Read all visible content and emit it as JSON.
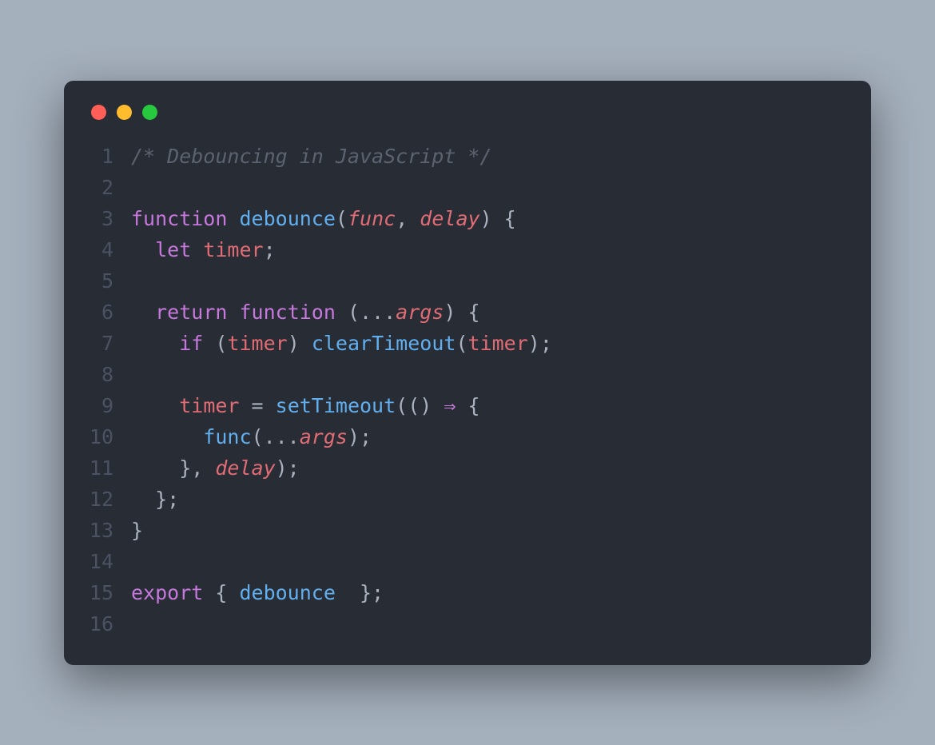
{
  "window": {
    "buttons": [
      "close",
      "minimize",
      "zoom"
    ]
  },
  "code": {
    "lines": [
      {
        "num": "1",
        "tokens": [
          {
            "cls": "tok-comment",
            "t": "/* Debouncing in JavaScript */"
          }
        ]
      },
      {
        "num": "2",
        "tokens": []
      },
      {
        "num": "3",
        "tokens": [
          {
            "cls": "tok-keyword",
            "t": "function"
          },
          {
            "cls": "tok-punct",
            "t": " "
          },
          {
            "cls": "tok-funcname",
            "t": "debounce"
          },
          {
            "cls": "tok-punct",
            "t": "("
          },
          {
            "cls": "tok-param",
            "t": "func"
          },
          {
            "cls": "tok-punct",
            "t": ", "
          },
          {
            "cls": "tok-param",
            "t": "delay"
          },
          {
            "cls": "tok-punct",
            "t": ") {"
          }
        ]
      },
      {
        "num": "4",
        "tokens": [
          {
            "cls": "tok-punct",
            "t": "  "
          },
          {
            "cls": "tok-let",
            "t": "let"
          },
          {
            "cls": "tok-punct",
            "t": " "
          },
          {
            "cls": "tok-var",
            "t": "timer"
          },
          {
            "cls": "tok-punct",
            "t": ";"
          }
        ]
      },
      {
        "num": "5",
        "tokens": []
      },
      {
        "num": "6",
        "tokens": [
          {
            "cls": "tok-punct",
            "t": "  "
          },
          {
            "cls": "tok-keyword",
            "t": "return"
          },
          {
            "cls": "tok-punct",
            "t": " "
          },
          {
            "cls": "tok-keyword",
            "t": "function"
          },
          {
            "cls": "tok-punct",
            "t": " (..."
          },
          {
            "cls": "tok-param",
            "t": "args"
          },
          {
            "cls": "tok-punct",
            "t": ") {"
          }
        ]
      },
      {
        "num": "7",
        "tokens": [
          {
            "cls": "tok-punct",
            "t": "    "
          },
          {
            "cls": "tok-keyword",
            "t": "if"
          },
          {
            "cls": "tok-punct",
            "t": " ("
          },
          {
            "cls": "tok-var",
            "t": "timer"
          },
          {
            "cls": "tok-punct",
            "t": ") "
          },
          {
            "cls": "tok-funcname",
            "t": "clearTimeout"
          },
          {
            "cls": "tok-punct",
            "t": "("
          },
          {
            "cls": "tok-var",
            "t": "timer"
          },
          {
            "cls": "tok-punct",
            "t": ");"
          }
        ]
      },
      {
        "num": "8",
        "tokens": []
      },
      {
        "num": "9",
        "tokens": [
          {
            "cls": "tok-punct",
            "t": "    "
          },
          {
            "cls": "tok-var",
            "t": "timer"
          },
          {
            "cls": "tok-punct",
            "t": " = "
          },
          {
            "cls": "tok-funcname",
            "t": "setTimeout"
          },
          {
            "cls": "tok-punct",
            "t": "(() "
          },
          {
            "cls": "tok-arrow",
            "t": "⇒"
          },
          {
            "cls": "tok-punct",
            "t": " {"
          }
        ]
      },
      {
        "num": "10",
        "tokens": [
          {
            "cls": "tok-punct",
            "t": "      "
          },
          {
            "cls": "tok-funcname",
            "t": "func"
          },
          {
            "cls": "tok-punct",
            "t": "(..."
          },
          {
            "cls": "tok-param",
            "t": "args"
          },
          {
            "cls": "tok-punct",
            "t": ");"
          }
        ]
      },
      {
        "num": "11",
        "tokens": [
          {
            "cls": "tok-punct",
            "t": "    }, "
          },
          {
            "cls": "tok-param",
            "t": "delay"
          },
          {
            "cls": "tok-punct",
            "t": ");"
          }
        ]
      },
      {
        "num": "12",
        "tokens": [
          {
            "cls": "tok-punct",
            "t": "  };"
          }
        ]
      },
      {
        "num": "13",
        "tokens": [
          {
            "cls": "tok-punct",
            "t": "}"
          }
        ]
      },
      {
        "num": "14",
        "tokens": []
      },
      {
        "num": "15",
        "tokens": [
          {
            "cls": "tok-keyword",
            "t": "export"
          },
          {
            "cls": "tok-punct",
            "t": " { "
          },
          {
            "cls": "tok-funcname",
            "t": "debounce"
          },
          {
            "cls": "tok-punct",
            "t": "  };"
          }
        ]
      },
      {
        "num": "16",
        "tokens": []
      }
    ]
  }
}
